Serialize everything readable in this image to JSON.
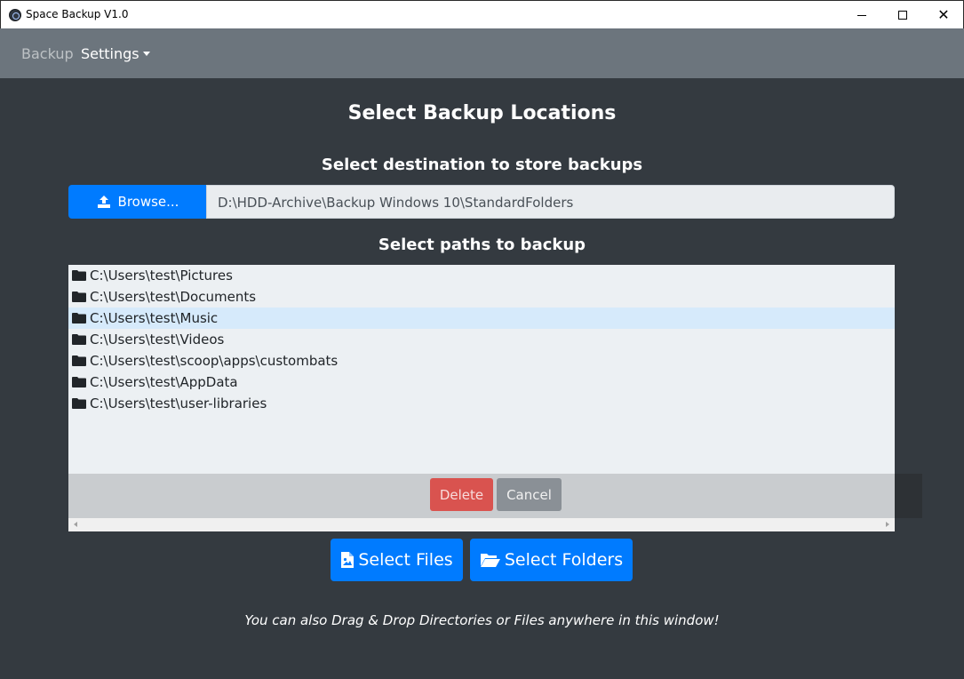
{
  "window": {
    "title": "Space Backup V1.0",
    "close_symbol": "✕"
  },
  "navbar": {
    "backup_label": "Backup",
    "settings_label": "Settings"
  },
  "page": {
    "title": "Select Backup Locations",
    "destination_heading": "Select destination to store backups",
    "paths_heading": "Select paths to backup",
    "hint": "You can also Drag & Drop Directories or Files anywhere in this window!"
  },
  "destination": {
    "browse_label": "Browse...",
    "path": "D:\\HDD-Archive\\Backup Windows 10\\StandardFolders"
  },
  "paths": [
    {
      "path": "C:\\Users\\test\\Pictures",
      "icon": "folder-icon",
      "selected": false
    },
    {
      "path": "C:\\Users\\test\\Documents",
      "icon": "folder-icon",
      "selected": false
    },
    {
      "path": "C:\\Users\\test\\Music",
      "icon": "folder-icon",
      "selected": true
    },
    {
      "path": "C:\\Users\\test\\Videos",
      "icon": "folder-icon",
      "selected": false
    },
    {
      "path": "C:\\Users\\test\\scoop\\apps\\custombats",
      "icon": "folder-icon",
      "selected": false
    },
    {
      "path": "C:\\Users\\test\\AppData",
      "icon": "folder-icon",
      "selected": false
    },
    {
      "path": "C:\\Users\\test\\user-libraries",
      "icon": "folder-icon",
      "selected": false
    }
  ],
  "actions": {
    "delete_label": "Delete",
    "cancel_label": "Cancel"
  },
  "buttons": {
    "select_files_label": "Select Files",
    "select_folders_label": "Select Folders"
  },
  "colors": {
    "primary": "#007bff",
    "danger": "#d9534f",
    "secondary": "#8a9096",
    "background": "#343a40",
    "navbar": "#6c757d",
    "list_bg": "#ecf0f3",
    "selected_row": "#d6eafb"
  }
}
